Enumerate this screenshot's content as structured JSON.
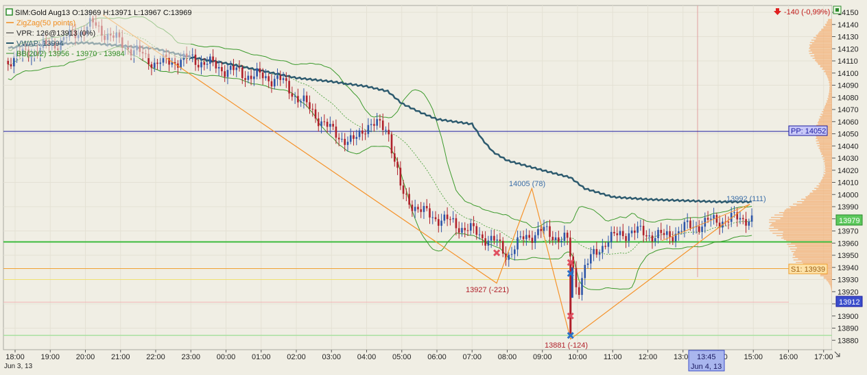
{
  "instrument": {
    "title": "SIM:Gold Aug13",
    "ohlc": "O:13969 H:13971 L:13967 C:13969"
  },
  "indicators": [
    {
      "label": "ZigZag(50 points)",
      "color": "#f08c1e"
    },
    {
      "label": "VPR: 126@13913 (0%)",
      "color": "#222222"
    },
    {
      "label": "VWAP: 13994",
      "color": "#2d5a6e"
    },
    {
      "label": "BB(20/2) 13956 - 13970 - 13984",
      "color": "#2e8b22"
    }
  ],
  "change": "-140 (-0,99%)",
  "colors": {
    "background": "#f0eee4",
    "bull": "#2d55a8",
    "bear": "#b0202a",
    "vwap": "#2d5a6e",
    "bollinger": "#3c9a2c",
    "zigzag": "#f5922a",
    "pivot": "#1a1aa0",
    "support": "#f0a030",
    "profile": "#f3b27a"
  },
  "levels": {
    "pp": {
      "label": "PP: 14052",
      "value": 14052
    },
    "s1": {
      "label": "S1: 13939",
      "value": 13939
    },
    "current": {
      "label": "13979",
      "value": 13979
    },
    "crosshair": {
      "label": "13912",
      "value": 13912
    }
  },
  "crosshair_time": {
    "time": "13:45",
    "date": "Jun 4, 13"
  },
  "annotations": [
    {
      "text": "14005 (78)",
      "color": "#3b6ea8"
    },
    {
      "text": "13927 (-221)",
      "color": "#b0202a"
    },
    {
      "text": "13881 (-124)",
      "color": "#b0202a"
    },
    {
      "text": "13992 (111)",
      "color": "#3b6ea8"
    }
  ],
  "y_axis": {
    "ticks": [
      14150,
      14140,
      14130,
      14120,
      14110,
      14100,
      14090,
      14080,
      14070,
      14060,
      14050,
      14040,
      14030,
      14020,
      14010,
      14000,
      13990,
      13980,
      13970,
      13960,
      13950,
      13940,
      13930,
      13920,
      13910,
      13900,
      13890,
      13880
    ]
  },
  "x_axis": {
    "ticks": [
      "18:00",
      "19:00",
      "20:00",
      "21:00",
      "22:00",
      "23:00",
      "00:00",
      "01:00",
      "02:00",
      "03:00",
      "04:00",
      "05:00",
      "06:00",
      "07:00",
      "08:00",
      "09:00",
      "10:00",
      "11:00",
      "12:00",
      "13:00",
      "14:00",
      "15:00",
      "16:00",
      "17:00"
    ],
    "start_date": "Jun 3, 13"
  }
}
